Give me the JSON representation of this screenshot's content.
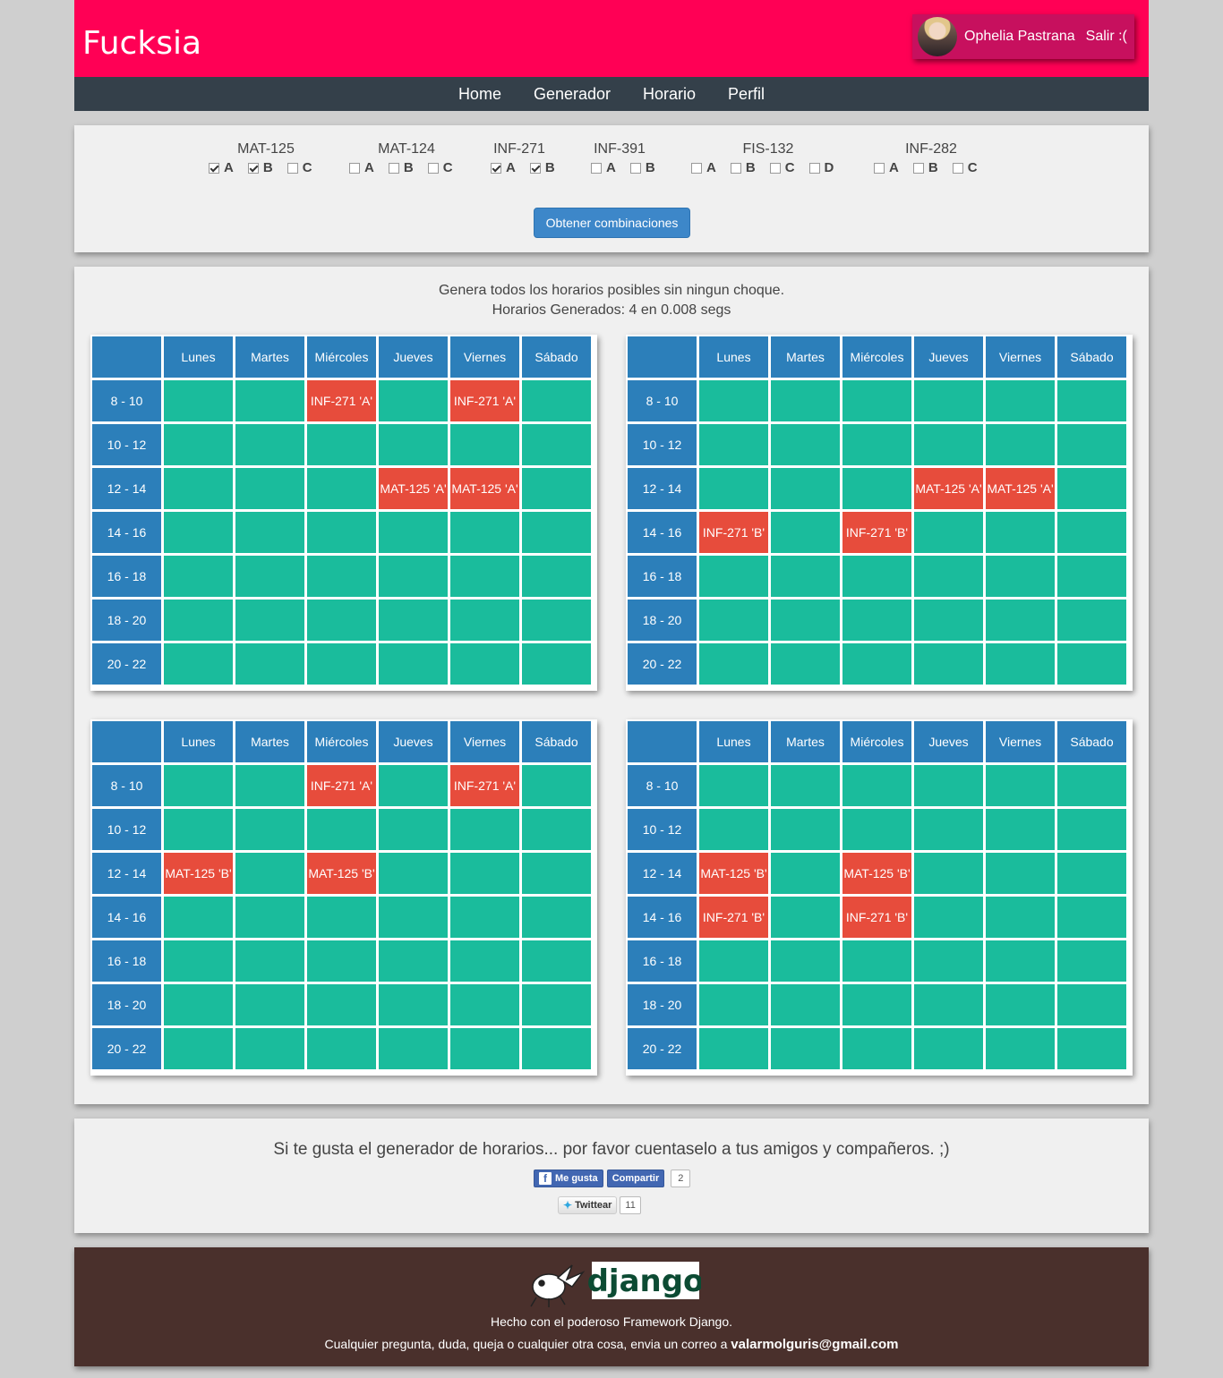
{
  "app": {
    "brand": "Fucksia"
  },
  "user": {
    "name": "Ophelia Pastrana",
    "logout_label": "Salir :("
  },
  "nav": [
    {
      "label": "Home"
    },
    {
      "label": "Generador"
    },
    {
      "label": "Horario"
    },
    {
      "label": "Perfil"
    }
  ],
  "courses": [
    {
      "name": "MAT-125",
      "options": [
        {
          "label": "A",
          "checked": true
        },
        {
          "label": "B",
          "checked": true
        },
        {
          "label": "C",
          "checked": false
        }
      ]
    },
    {
      "name": "MAT-124",
      "options": [
        {
          "label": "A",
          "checked": false
        },
        {
          "label": "B",
          "checked": false
        },
        {
          "label": "C",
          "checked": false
        }
      ]
    },
    {
      "name": "INF-271",
      "options": [
        {
          "label": "A",
          "checked": true
        },
        {
          "label": "B",
          "checked": true
        }
      ]
    },
    {
      "name": "INF-391",
      "options": [
        {
          "label": "A",
          "checked": false
        },
        {
          "label": "B",
          "checked": false
        }
      ]
    },
    {
      "name": "FIS-132",
      "options": [
        {
          "label": "A",
          "checked": false
        },
        {
          "label": "B",
          "checked": false
        },
        {
          "label": "C",
          "checked": false
        },
        {
          "label": "D",
          "checked": false
        }
      ]
    },
    {
      "name": "INF-282",
      "options": [
        {
          "label": "A",
          "checked": false
        },
        {
          "label": "B",
          "checked": false
        },
        {
          "label": "C",
          "checked": false
        }
      ]
    }
  ],
  "generate_button": "Obtener combinaciones",
  "results": {
    "description": "Genera todos los horarios posibles sin ningun choque.",
    "summary": "Horarios Generados: 4 en 0.008 segs"
  },
  "days": [
    "Lunes",
    "Martes",
    "Miércoles",
    "Jueves",
    "Viernes",
    "Sábado"
  ],
  "times": [
    "8 - 10",
    "10 - 12",
    "12 - 14",
    "14 - 16",
    "16 - 18",
    "18 - 20",
    "20 - 22"
  ],
  "schedules": [
    {
      "slots": [
        [
          "",
          "",
          "INF-271 'A'",
          "",
          "INF-271 'A'",
          ""
        ],
        [
          "",
          "",
          "",
          "",
          "",
          ""
        ],
        [
          "",
          "",
          "",
          "MAT-125 'A'",
          "MAT-125 'A'",
          ""
        ],
        [
          "",
          "",
          "",
          "",
          "",
          ""
        ],
        [
          "",
          "",
          "",
          "",
          "",
          ""
        ],
        [
          "",
          "",
          "",
          "",
          "",
          ""
        ],
        [
          "",
          "",
          "",
          "",
          "",
          ""
        ]
      ]
    },
    {
      "slots": [
        [
          "",
          "",
          "",
          "",
          "",
          ""
        ],
        [
          "",
          "",
          "",
          "",
          "",
          ""
        ],
        [
          "",
          "",
          "",
          "MAT-125 'A'",
          "MAT-125 'A'",
          ""
        ],
        [
          "INF-271 'B'",
          "",
          "INF-271 'B'",
          "",
          "",
          ""
        ],
        [
          "",
          "",
          "",
          "",
          "",
          ""
        ],
        [
          "",
          "",
          "",
          "",
          "",
          ""
        ],
        [
          "",
          "",
          "",
          "",
          "",
          ""
        ]
      ]
    },
    {
      "slots": [
        [
          "",
          "",
          "INF-271 'A'",
          "",
          "INF-271 'A'",
          ""
        ],
        [
          "",
          "",
          "",
          "",
          "",
          ""
        ],
        [
          "MAT-125 'B'",
          "",
          "MAT-125 'B'",
          "",
          "",
          ""
        ],
        [
          "",
          "",
          "",
          "",
          "",
          ""
        ],
        [
          "",
          "",
          "",
          "",
          "",
          ""
        ],
        [
          "",
          "",
          "",
          "",
          "",
          ""
        ],
        [
          "",
          "",
          "",
          "",
          "",
          ""
        ]
      ]
    },
    {
      "slots": [
        [
          "",
          "",
          "",
          "",
          "",
          ""
        ],
        [
          "",
          "",
          "",
          "",
          "",
          ""
        ],
        [
          "MAT-125 'B'",
          "",
          "MAT-125 'B'",
          "",
          "",
          ""
        ],
        [
          "INF-271 'B'",
          "",
          "INF-271 'B'",
          "",
          "",
          ""
        ],
        [
          "",
          "",
          "",
          "",
          "",
          ""
        ],
        [
          "",
          "",
          "",
          "",
          "",
          ""
        ],
        [
          "",
          "",
          "",
          "",
          "",
          ""
        ]
      ]
    }
  ],
  "share": {
    "text": "Si te gusta el generador de horarios... por favor cuentaselo a tus amigos y compañeros. ;)",
    "fb_like": "Me gusta",
    "fb_share": "Compartir",
    "fb_count": "2",
    "tweet": "Twittear",
    "tweet_count": "11"
  },
  "footer": {
    "logo_text": "django",
    "line1": "Hecho con el poderoso Framework Django.",
    "line2": "Cualquier pregunta, duda, queja o cualquier otra cosa, envia un correo a ",
    "email": "valarmolguris@gmail.com"
  },
  "colors": {
    "header": "#ff0055",
    "nav": "#34404a",
    "cell_header": "#2c7fba",
    "cell_free": "#1abc9c",
    "cell_busy": "#e74c3c",
    "footer": "#4a302c"
  }
}
